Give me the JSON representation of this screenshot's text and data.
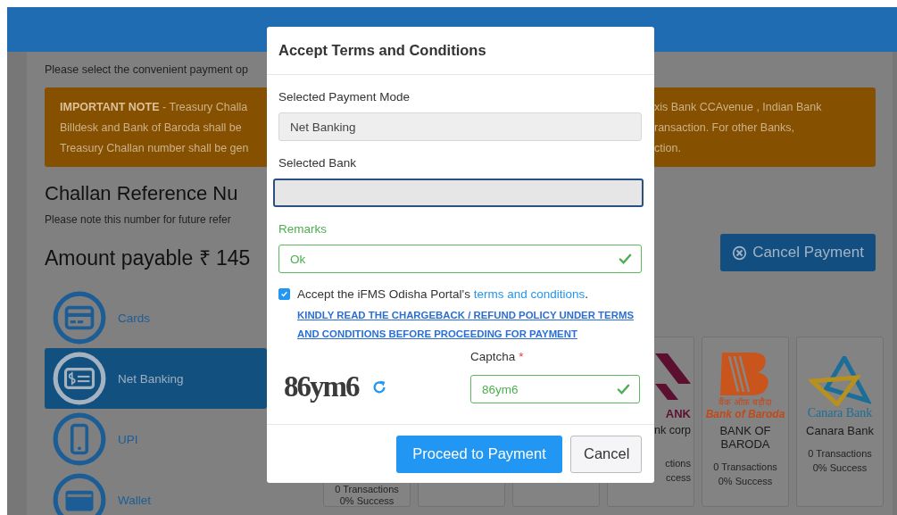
{
  "page": {
    "instruction": "Please select the convenient payment op",
    "important_note": {
      "left_lines": [
        "**IMPORTANT NOTE** - Treasury Challa",
        "Billdesk and Bank of Baroda shall be",
        "Treasury Challan number shall be gen"
      ],
      "right_lines": [
        "xis Bank CCAvenue , Indian Bank",
        "ransaction. For other Banks,",
        "ction."
      ]
    },
    "challan_heading": "Challan Reference Nu",
    "challan_hint": "Please note this number for future refer",
    "amount": "Amount payable ₹ 145",
    "cancel_button": "Cancel Payment"
  },
  "payment_modes": [
    {
      "kind": "cards",
      "label": "Cards",
      "selected": false
    },
    {
      "kind": "netbanking",
      "label": "Net Banking",
      "selected": true
    },
    {
      "kind": "upi",
      "label": "UPI",
      "selected": false
    },
    {
      "kind": "wallet",
      "label": "Wallet",
      "selected": false
    }
  ],
  "banks": [
    {
      "kind": "partial",
      "transactions": "0 Transactions",
      "success": "0% Success"
    },
    {
      "kind": "kotak",
      "logo_text": "ANK",
      "name": "nk corp",
      "transactions": "ctions",
      "success": "ccess"
    },
    {
      "kind": "bob",
      "logo_script": "बैंक ऑफ़ बड़ौदा",
      "logo_text": "Bank of Baroda",
      "name": "BANK OF BARODA",
      "transactions": "0 Transactions",
      "success": "0% Success"
    },
    {
      "kind": "canara",
      "logo_text": "Canara Bank",
      "name": "Canara Bank",
      "transactions": "0 Transactions",
      "success": "0% Success"
    }
  ],
  "modal": {
    "title": "Accept Terms and Conditions",
    "fields": [
      {
        "label": "Selected Payment Mode",
        "value": "Net Banking",
        "readonly": true,
        "focused": false,
        "valid": false
      },
      {
        "label": "Selected Bank",
        "readonly": true,
        "focused": true,
        "valid": false
      },
      {
        "label": "Remarks",
        "value": "Ok",
        "readonly": false,
        "focused": false,
        "valid": true
      }
    ],
    "accept": {
      "checked": true,
      "text": "Accept the iFMS Odisha Portal's ",
      "link": "terms and conditions",
      "end": ".",
      "policy_link": "KINDLY READ THE CHARGEBACK / REFUND POLICY UNDER TERMS AND CONDITIONS BEFORE PROCEEDING FOR PAYMENT"
    },
    "captcha": {
      "image_text": "86ym6",
      "label": "Captcha",
      "required_mark": "*",
      "value": "86ym6",
      "valid": true
    },
    "buttons": [
      {
        "label": "Proceed to Payment",
        "kind": "primary"
      },
      {
        "label": "Cancel",
        "kind": "secondary"
      }
    ]
  }
}
